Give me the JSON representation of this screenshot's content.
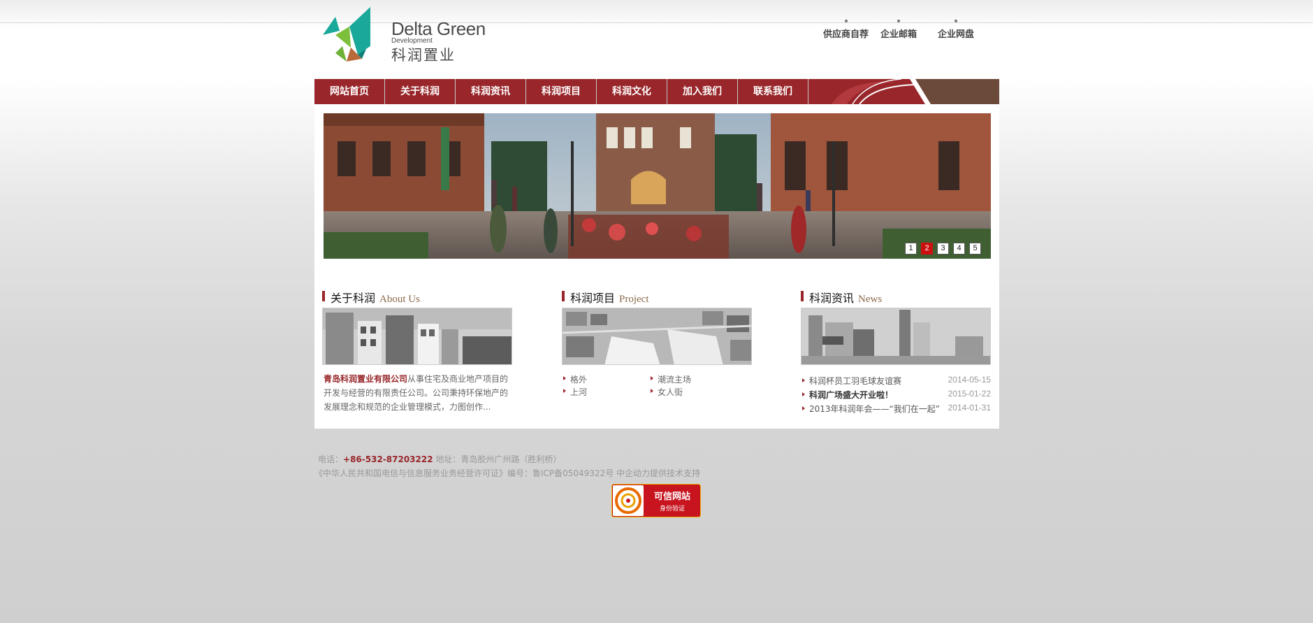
{
  "brand": {
    "name_en": "Delta Green",
    "name_sub": "Development",
    "name_cn": "科润置业"
  },
  "top_links": [
    "供应商自荐",
    "企业邮箱",
    "企业网盘"
  ],
  "nav": [
    "网站首页",
    "关于科润",
    "科润资讯",
    "科润项目",
    "科润文化",
    "加入我们",
    "联系我们"
  ],
  "banner": {
    "pages": [
      "1",
      "2",
      "3",
      "4",
      "5"
    ],
    "active_page": 2
  },
  "about": {
    "title_cn": "关于科润",
    "title_en": "About Us",
    "company": "青岛科润置业有限公司",
    "text": "从事住宅及商业地产项目的开发与经营的有限责任公司。公司秉持环保地产的发展理念和规范的企业管理模式，力图创作..."
  },
  "projects": {
    "title_cn": "科润项目",
    "title_en": "Project",
    "items": [
      "格外",
      "潮流主场",
      "上河",
      "女人街"
    ]
  },
  "news": {
    "title_cn": "科润资讯",
    "title_en": "News",
    "items": [
      {
        "title": "科润杯员工羽毛球友谊赛",
        "date": "2014-05-15",
        "bold": false
      },
      {
        "title": "科润广场盛大开业啦！",
        "date": "2015-01-22",
        "bold": true
      },
      {
        "title": "2013年科润年会——“我们在一起”",
        "date": "2014-01-31",
        "bold": false
      }
    ]
  },
  "footer": {
    "phone_label": "电话：",
    "phone": "+86-532-87203222",
    "address": " 地址：青岛胶州广州路（胜利桥）",
    "line2": "《中华人民共和国电信与信息服务业务经营许可证》编号：鲁ICP备05049322号 中企动力提供技术支持",
    "badge_title": "可信网站",
    "badge_sub": "身份验证"
  },
  "colors": {
    "brand_red": "#98262a",
    "accent_brown": "#6b4a3a",
    "logo_teal": "#1aa89a"
  }
}
